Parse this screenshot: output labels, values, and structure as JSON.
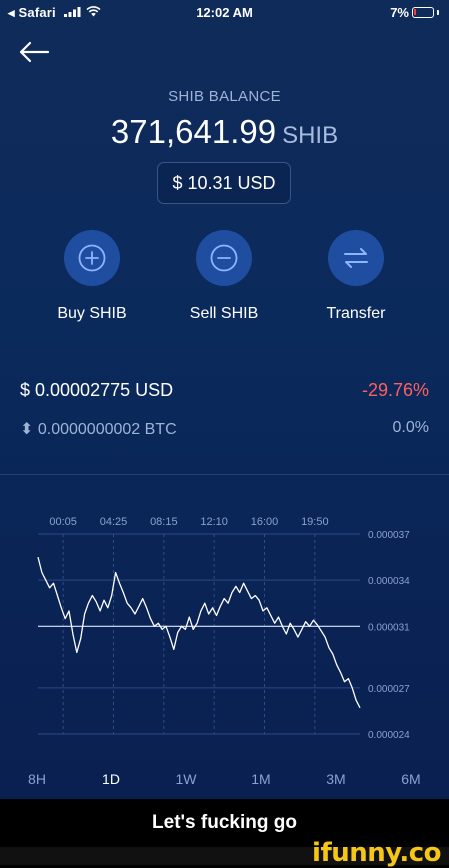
{
  "status_bar": {
    "back_app": "◂ Safari",
    "time": "12:02 AM",
    "battery": "7%"
  },
  "balance": {
    "label": "SHIB BALANCE",
    "amount": "371,641.99",
    "unit": "SHIB",
    "usd_value": "$ 10.31 USD"
  },
  "actions": [
    {
      "label": "Buy SHIB",
      "icon": "plus-icon"
    },
    {
      "label": "Sell SHIB",
      "icon": "minus-icon"
    },
    {
      "label": "Transfer",
      "icon": "transfer-arrows-icon"
    }
  ],
  "price": {
    "usd": "$ 0.00002775 USD",
    "change": "-29.76%",
    "btc": "⬍ 0.0000000002 BTC",
    "btc_change": "0.0%"
  },
  "chart_data": {
    "type": "line",
    "x_tick_labels": [
      "00:05",
      "04:25",
      "08:15",
      "12:10",
      "16:00",
      "19:50"
    ],
    "y_tick_labels": [
      "0.000037",
      "0.000034",
      "0.000031",
      "0.000027",
      "0.000024"
    ],
    "ylim": [
      2.4e-05,
      3.7e-05
    ],
    "reference_line": 3.1e-05,
    "series": [
      {
        "values": [
          3.55e-05,
          3.45e-05,
          3.4e-05,
          3.35e-05,
          3.38e-05,
          3.3e-05,
          3.22e-05,
          3.15e-05,
          3.2e-05,
          3.05e-05,
          2.93e-05,
          3.02e-05,
          3.18e-05,
          3.25e-05,
          3.3e-05,
          3.26e-05,
          3.2e-05,
          3.27e-05,
          3.22e-05,
          3.3e-05,
          3.45e-05,
          3.38e-05,
          3.32e-05,
          3.25e-05,
          3.22e-05,
          3.18e-05,
          3.23e-05,
          3.28e-05,
          3.22e-05,
          3.15e-05,
          3.1e-05,
          3.12e-05,
          3.08e-05,
          3.1e-05,
          3.03e-05,
          2.95e-05,
          3.06e-05,
          3.1e-05,
          3.08e-05,
          3.16e-05,
          3.08e-05,
          3.12e-05,
          3.2e-05,
          3.25e-05,
          3.18e-05,
          3.22e-05,
          3.17e-05,
          3.23e-05,
          3.28e-05,
          3.25e-05,
          3.32e-05,
          3.36e-05,
          3.32e-05,
          3.38e-05,
          3.33e-05,
          3.28e-05,
          3.3e-05,
          3.27e-05,
          3.2e-05,
          3.22e-05,
          3.17e-05,
          3.12e-05,
          3.16e-05,
          3.1e-05,
          3.05e-05,
          3.12e-05,
          3.08e-05,
          3.03e-05,
          3.08e-05,
          3.13e-05,
          3.1e-05,
          3.14e-05,
          3.11e-05,
          3.07e-05,
          3.03e-05,
          2.96e-05,
          2.92e-05,
          2.85e-05,
          2.8e-05,
          2.74e-05,
          2.76e-05,
          2.7e-05,
          2.62e-05,
          2.57e-05
        ]
      }
    ],
    "ranges": [
      "8H",
      "1D",
      "1W",
      "1M",
      "3M",
      "6M"
    ],
    "active_range": "1D",
    "grid": true
  },
  "caption": "Let's fucking go",
  "watermark": "ifunny.co",
  "colors": {
    "background": "#0b2a5c",
    "accent": "#1f4ea0",
    "negative": "#ff5f5f",
    "muted": "#9fb3d6"
  }
}
